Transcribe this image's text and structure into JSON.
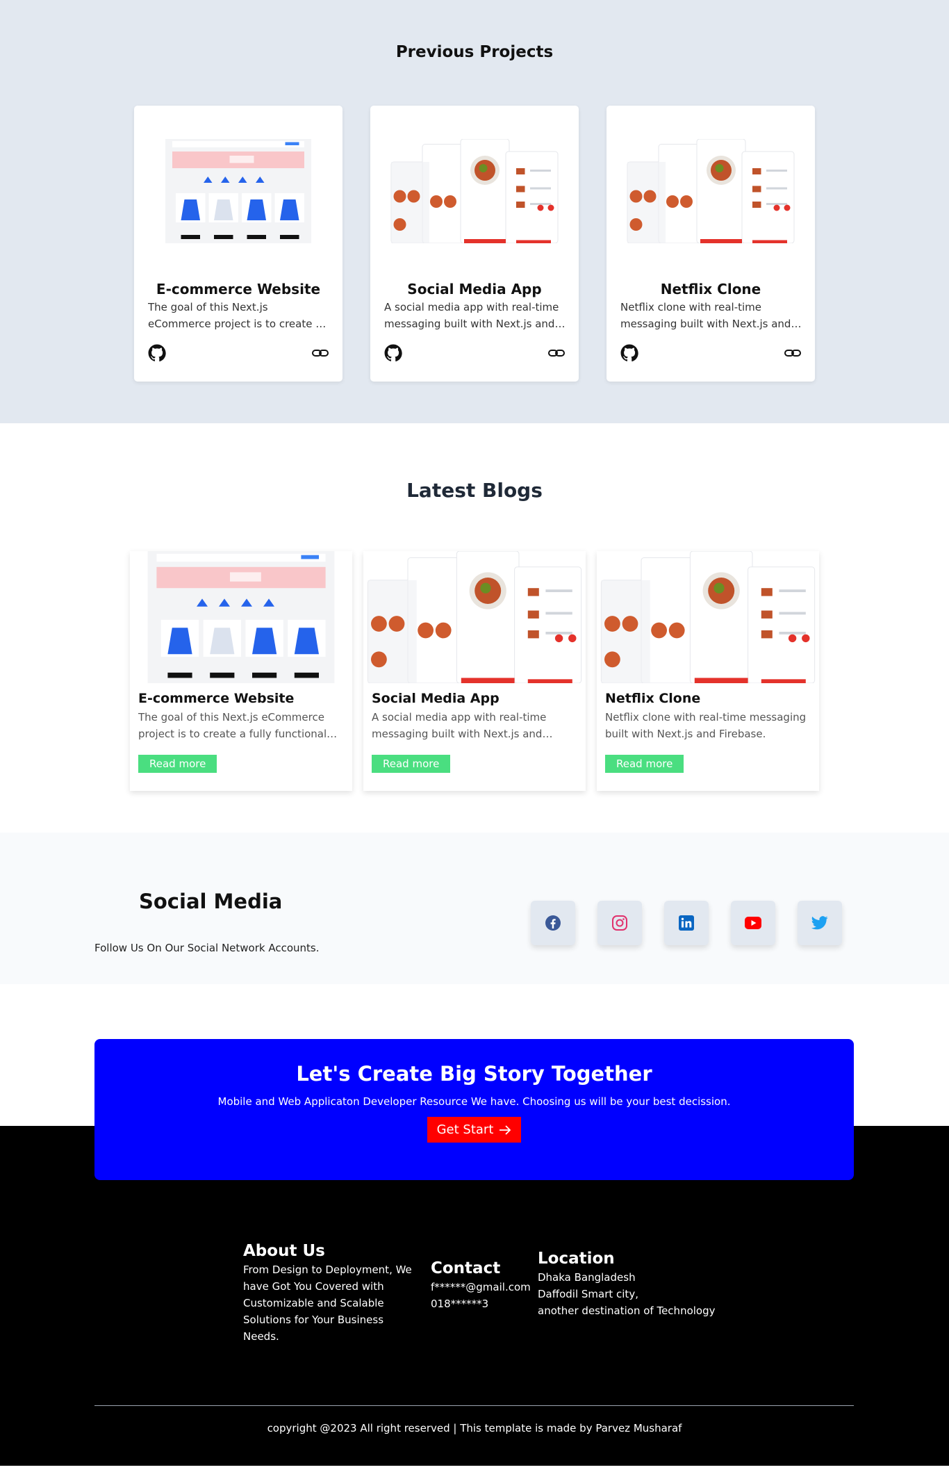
{
  "projects": {
    "heading": "Previous Projects",
    "items": [
      {
        "title": "E-commerce Website",
        "description": "The goal of this Next.js eCommerce project is to create a fully functional eCommerce website.",
        "thumb": "ecommerce"
      },
      {
        "title": "Social Media App",
        "description": "A social media app with real-time messaging built with Next.js and Firebase.",
        "thumb": "food"
      },
      {
        "title": "Netflix Clone",
        "description": "Netflix clone with real-time messaging built with Next.js and Firebase.",
        "thumb": "food"
      }
    ],
    "icons": {
      "repo": "github-icon",
      "link": "link-icon"
    }
  },
  "blogs": {
    "heading": "Latest Blogs",
    "items": [
      {
        "title": "E-commerce Website",
        "description": "The goal of this Next.js eCommerce project is to create a fully functional eCommerce website.",
        "button": "Read more",
        "thumb": "ecommerce"
      },
      {
        "title": "Social Media App",
        "description": "A social media app with real-time messaging built with Next.js and Firebase.",
        "button": "Read more",
        "thumb": "food"
      },
      {
        "title": "Netflix Clone",
        "description": "Netflix clone with real-time messaging built with Next.js and Firebase.",
        "button": "Read more",
        "thumb": "food"
      }
    ]
  },
  "social": {
    "heading": "Social Media",
    "subtitle": "Follow Us On Our Social Network Accounts.",
    "icons": [
      {
        "name": "facebook-icon",
        "color": "#3b5998"
      },
      {
        "name": "instagram-icon",
        "color": "#e1306c"
      },
      {
        "name": "linkedin-icon",
        "color": "#0a66c2"
      },
      {
        "name": "youtube-icon",
        "color": "#ff0000"
      },
      {
        "name": "twitter-icon",
        "color": "#1da1f2"
      }
    ]
  },
  "cta": {
    "title": "Let's Create Big Story Together",
    "text": "Mobile and Web Applicaton Developer Resource We have. Choosing us will be your best decission.",
    "button": "Get Start",
    "button_icon": "arrow-right-icon"
  },
  "footer": {
    "about": {
      "title": "About Us",
      "text": "From Design to Deployment, We have Got You Covered with Customizable and Scalable Solutions for Your Business Needs."
    },
    "contact": {
      "title": "Contact",
      "email": "f******@gmail.com",
      "phone": "018******3"
    },
    "location": {
      "title": "Location",
      "line1": "Dhaka Bangladesh",
      "line2": "Daffodil Smart city,",
      "line3": "another destination of Technology"
    },
    "copyright": "copyright @2023 All right reserved | This template is made by Parvez Musharaf"
  },
  "colors": {
    "projects_bg": "#e2e8f0",
    "blog_button": "#4ade80",
    "cta_bg": "#0000ff",
    "cta_button": "#ff0000",
    "footer_bg": "#000000"
  }
}
